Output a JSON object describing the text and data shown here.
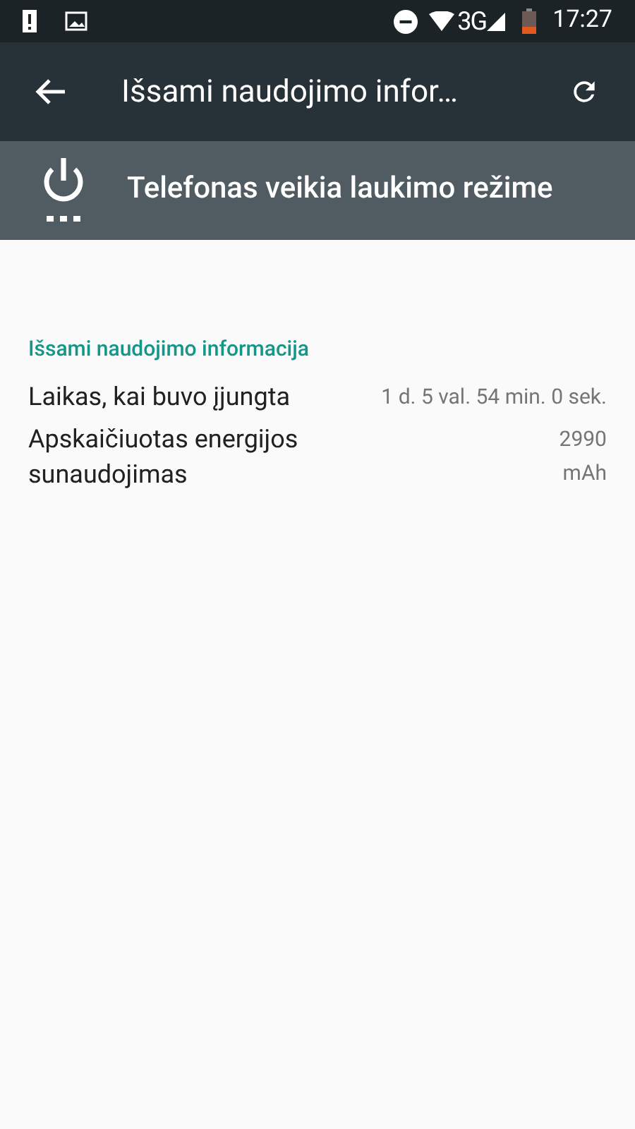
{
  "status_bar": {
    "time": "17:27",
    "network": "3G"
  },
  "toolbar": {
    "title": "Išsami naudojimo infor…"
  },
  "banner": {
    "text": "Telefonas veikia laukimo režime"
  },
  "section": {
    "title": "Išsami naudojimo informacija"
  },
  "rows": [
    {
      "label": "Laikas, kai buvo įjungta",
      "value": "1 d. 5 val. 54 min. 0 sek.",
      "wrap": false
    },
    {
      "label": "Apskaičiuotas energijos sunaudojimas",
      "value": "2990 mAh",
      "wrap": true
    }
  ]
}
